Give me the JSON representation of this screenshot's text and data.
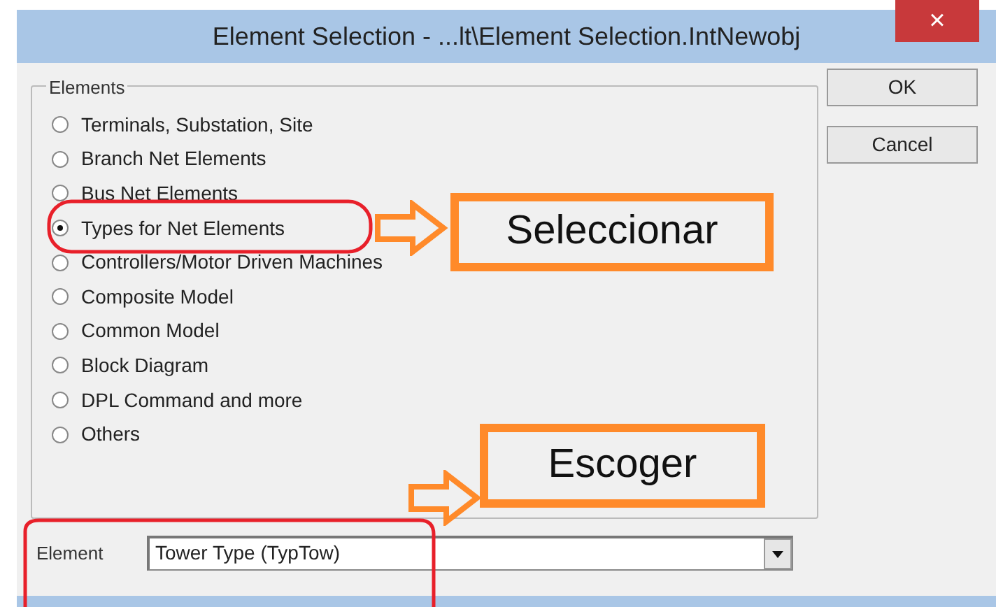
{
  "window": {
    "title": "Element Selection - ...lt\\Element Selection.IntNewobj",
    "close": "×"
  },
  "elements": {
    "legend": "Elements",
    "options": [
      {
        "label": "Terminals, Substation, Site",
        "selected": false
      },
      {
        "label": "Branch Net Elements",
        "selected": false
      },
      {
        "label": "Bus Net Elements",
        "selected": false
      },
      {
        "label": "Types for Net Elements",
        "selected": true
      },
      {
        "label": "Controllers/Motor Driven Machines",
        "selected": false
      },
      {
        "label": "Composite Model",
        "selected": false
      },
      {
        "label": "Common Model",
        "selected": false
      },
      {
        "label": "Block Diagram",
        "selected": false
      },
      {
        "label": "DPL Command and more",
        "selected": false
      },
      {
        "label": "Others",
        "selected": false
      }
    ]
  },
  "buttons": [
    "OK",
    "Cancel"
  ],
  "element": {
    "label": "Element",
    "value": "Tower Type (TypTow)"
  },
  "callouts": [
    {
      "text": "Seleccionar"
    },
    {
      "text": "Escoger"
    }
  ]
}
